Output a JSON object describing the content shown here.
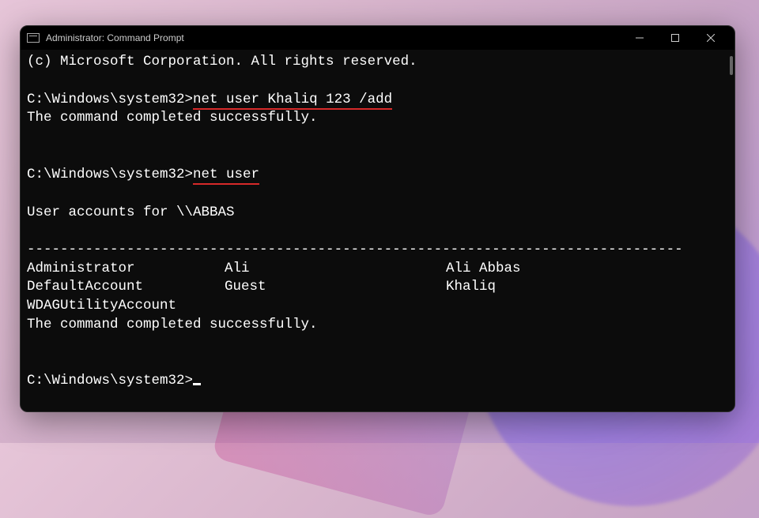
{
  "window": {
    "title": "Administrator: Command Prompt"
  },
  "terminal": {
    "copyright": "(c) Microsoft Corporation. All rights reserved.",
    "prompt": "C:\\Windows\\system32>",
    "cmd1": "net user Khaliq 123 /add",
    "success_msg": "The command completed successfully.",
    "cmd2": "net user",
    "user_accounts_header": "User accounts for \\\\ABBAS",
    "dash_line": "-------------------------------------------------------------------------------",
    "users": [
      [
        "Administrator",
        "Ali",
        "Ali Abbas"
      ],
      [
        "DefaultAccount",
        "Guest",
        "Khaliq"
      ],
      [
        "WDAGUtilityAccount",
        "",
        ""
      ]
    ]
  }
}
